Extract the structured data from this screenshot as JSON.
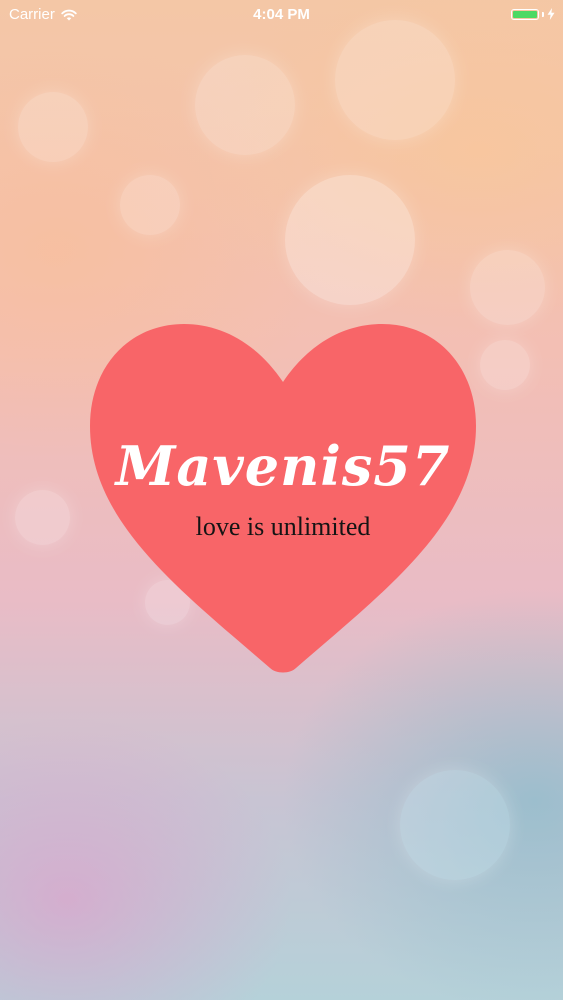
{
  "status_bar": {
    "carrier": "Carrier",
    "time": "4:04 PM",
    "battery_level": 1.0,
    "wifi_icon": "wifi-icon",
    "charging_icon": "bolt-icon",
    "battery_color": "#4cd964"
  },
  "splash": {
    "app_name": "Mavenis57",
    "tagline": "love is unlimited",
    "heart_color": "#f86568",
    "heart_icon": "heart-icon"
  }
}
